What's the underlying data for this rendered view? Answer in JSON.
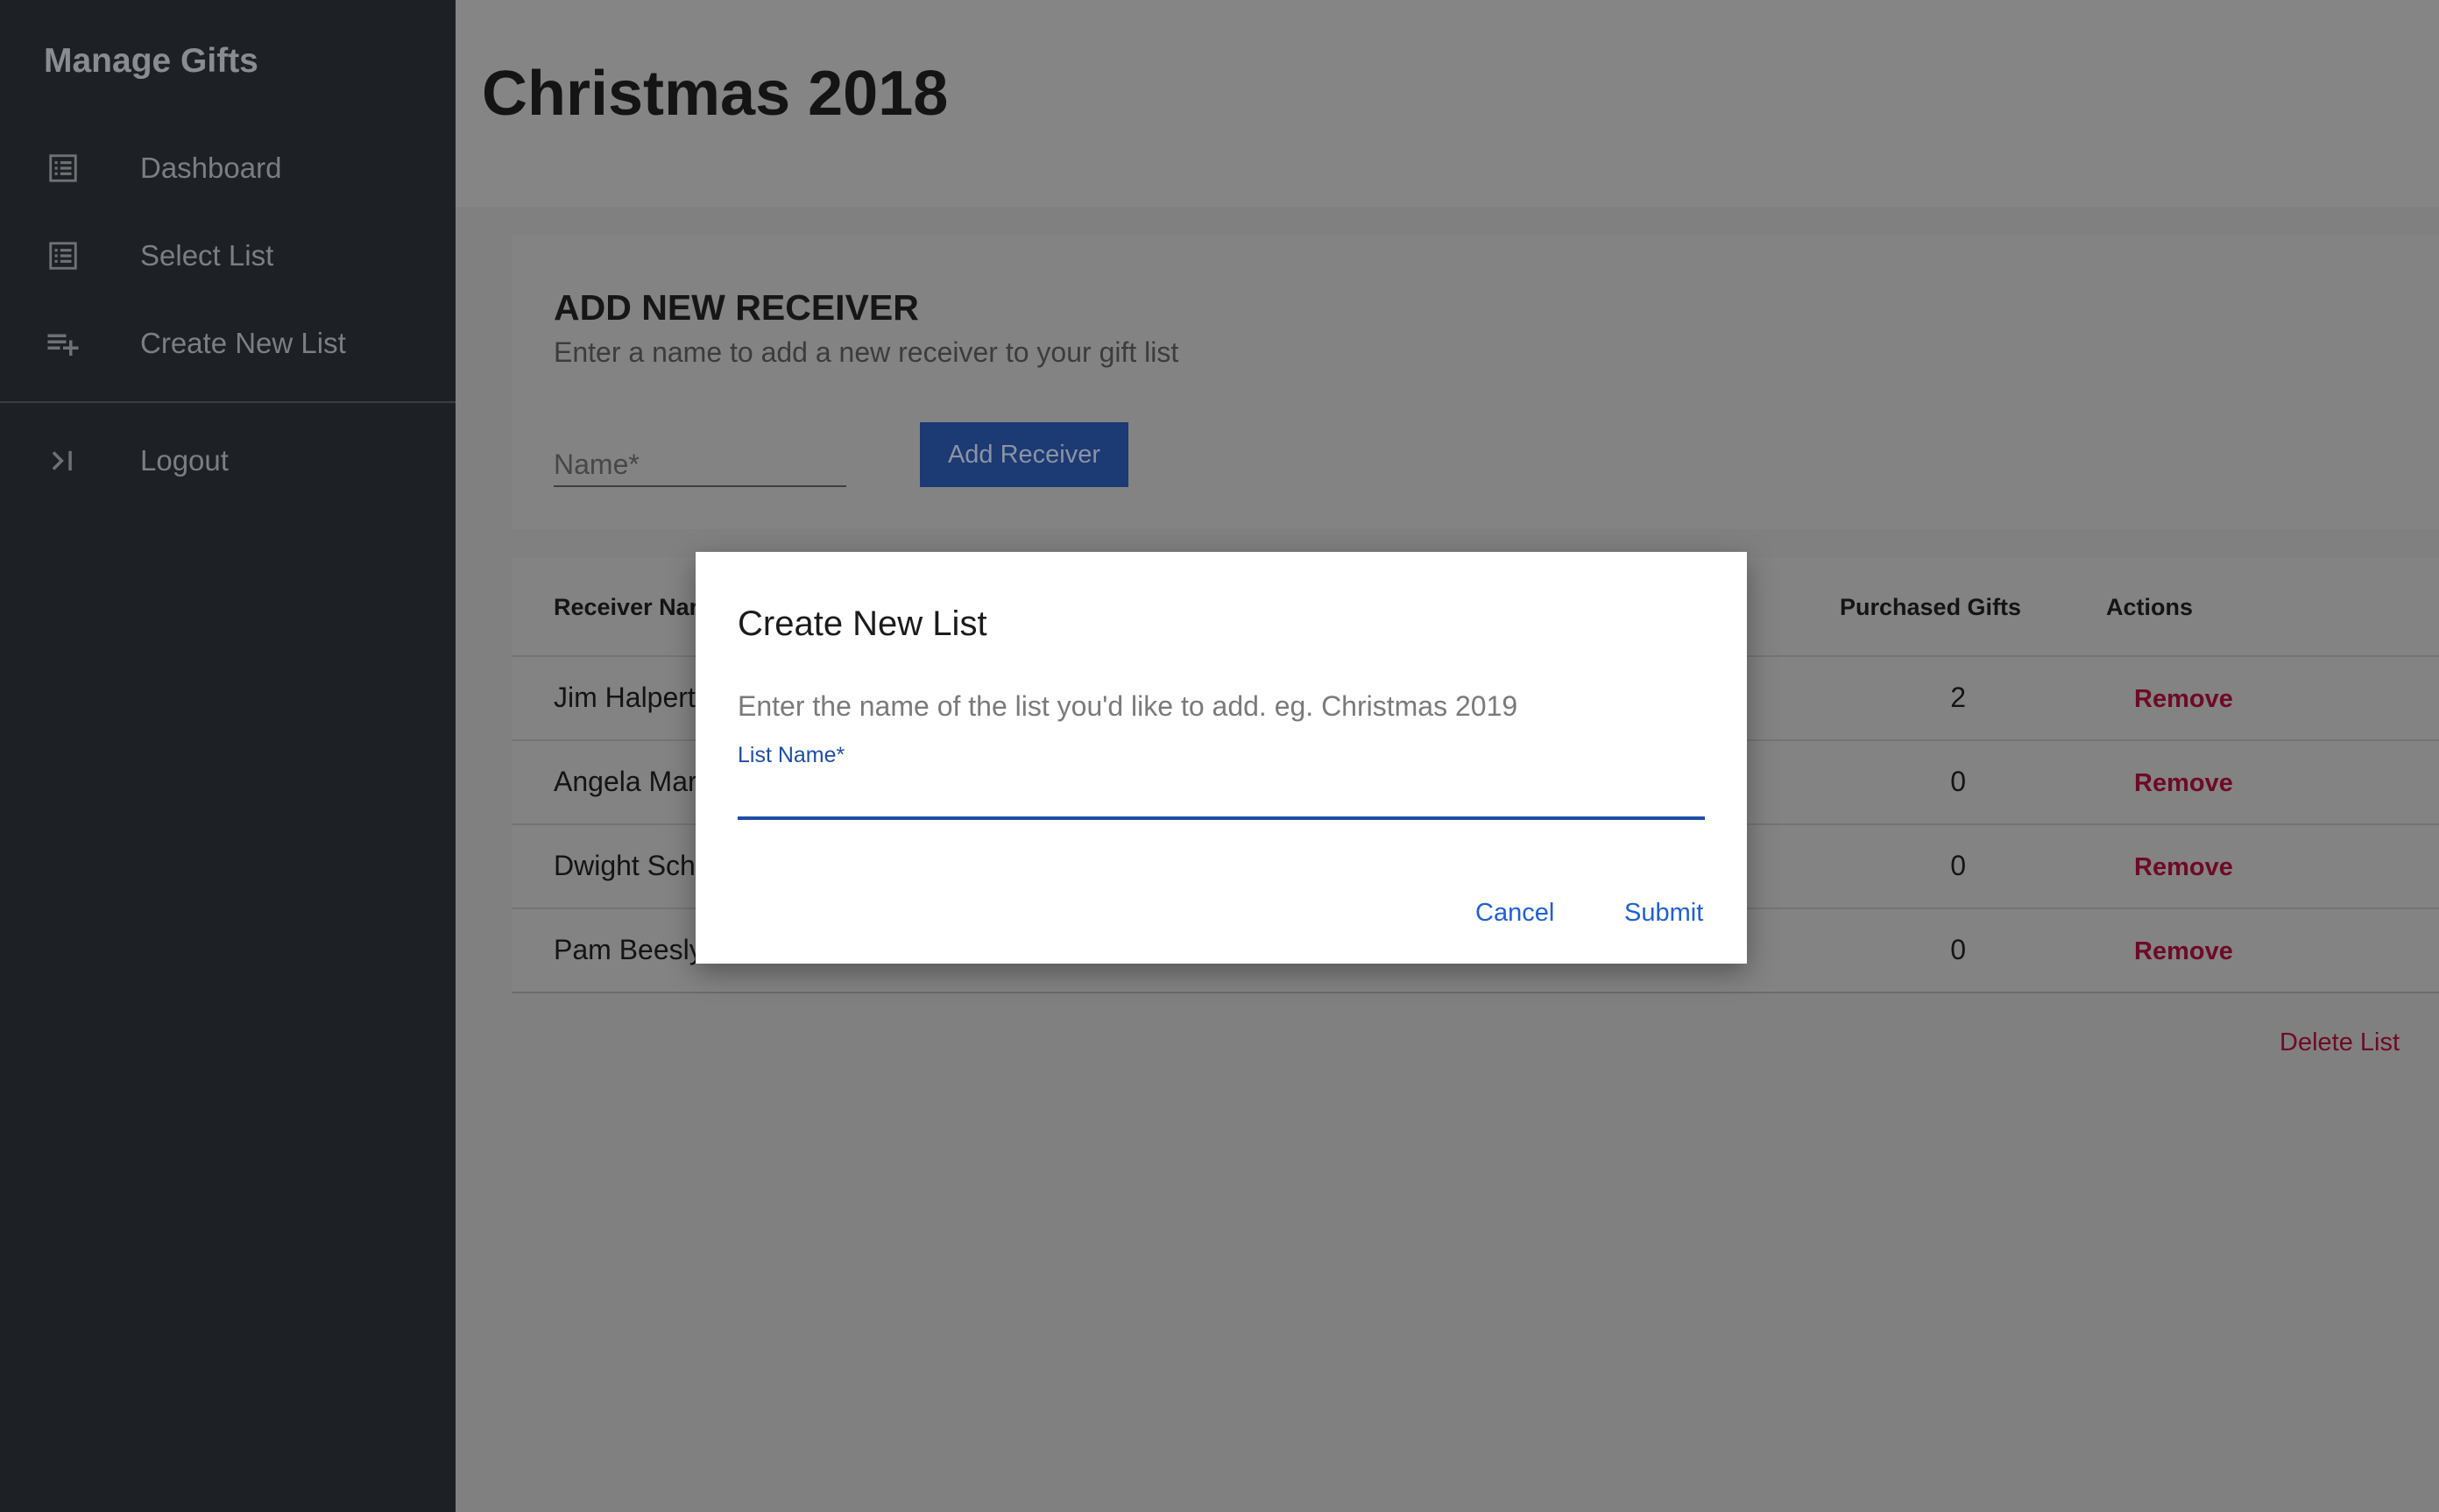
{
  "sidebar": {
    "title": "Manage Gifts",
    "items": [
      {
        "label": "Dashboard",
        "icon": "list-icon"
      },
      {
        "label": "Select List",
        "icon": "list-icon"
      },
      {
        "label": "Create New List",
        "icon": "playlist-add-icon"
      },
      {
        "label": "Logout",
        "icon": "logout-icon"
      }
    ]
  },
  "page": {
    "title": "Christmas 2018"
  },
  "add_receiver": {
    "title": "ADD NEW RECEIVER",
    "subtitle": "Enter a name to add a new receiver to your gift list",
    "name_placeholder": "Name*",
    "button_label": "Add Receiver"
  },
  "table": {
    "headers": {
      "name": "Receiver Nar",
      "purchased": "Purchased Gifts",
      "actions": "Actions"
    },
    "rows": [
      {
        "name": "Jim Halpert",
        "purchased": "2",
        "action": "Remove"
      },
      {
        "name": "Angela Mar",
        "purchased": "0",
        "action": "Remove"
      },
      {
        "name": "Dwight Sch",
        "purchased": "0",
        "action": "Remove"
      },
      {
        "name": "Pam Beesly",
        "purchased": "0",
        "action": "Remove"
      }
    ]
  },
  "delete_list_label": "Delete List",
  "dialog": {
    "title": "Create New List",
    "text": "Enter the name of the list you'd like to add. eg. Christmas 2019",
    "field_label": "List Name*",
    "field_value": "",
    "cancel_label": "Cancel",
    "submit_label": "Submit"
  },
  "colors": {
    "primary": "#1f4ea5",
    "danger": "#c2124a",
    "sidebar_bg": "#1d2125",
    "overlay": "#808080"
  }
}
